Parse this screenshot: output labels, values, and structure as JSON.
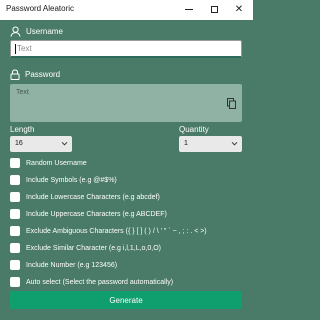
{
  "window": {
    "title": "Password Aleatoric",
    "min_icon": "minimize-icon",
    "max_icon": "maximize-icon",
    "close_symbol": "✕"
  },
  "username": {
    "label": "Username",
    "placeholder": "Text",
    "icon": "user-icon"
  },
  "password": {
    "label": "Password",
    "placeholder": "Text",
    "icon": "lock-icon",
    "copy_icon": "copy-icon"
  },
  "length": {
    "label": "Length",
    "selected": "16"
  },
  "quantity": {
    "label": "Quantity",
    "selected": "1"
  },
  "options": [
    {
      "label": "Random Username",
      "checked": false
    },
    {
      "label": "Include Symbols (e.g @#$%)",
      "checked": false
    },
    {
      "label": "Include Lowercase Characters (e.g abcdef)",
      "checked": false
    },
    {
      "label": "Include Uppercase Characters (e.g ABCDEF)",
      "checked": false
    },
    {
      "label": "Exclude Ambiguous Characters ({ } [ ] ( ) / \\ ' \" ` ~ , ; : . < >)",
      "checked": false
    },
    {
      "label": "Exclude Similar Character (e.g i,l,1,L,o,0,O)",
      "checked": false
    },
    {
      "label": "Include Number (e.g 123456)",
      "checked": false
    },
    {
      "label": "Auto select (Select the password automatically)",
      "checked": false
    }
  ],
  "generate_label": "Generate",
  "colors": {
    "background": "#4a7a68",
    "accent": "#0f9e6e",
    "password_box": "#8fb2a5"
  }
}
